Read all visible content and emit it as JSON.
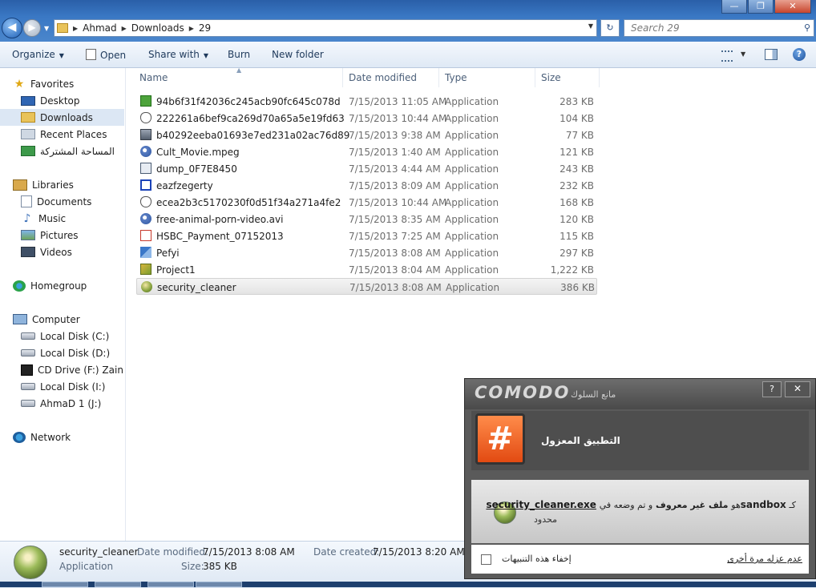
{
  "window": {
    "minimize_glyph": "—",
    "maximize_glyph": "❐",
    "close_glyph": "✕"
  },
  "address": {
    "crumbs": [
      "Ahmad",
      "Downloads",
      "29"
    ],
    "search_placeholder": "Search 29"
  },
  "toolbar": {
    "organize": "Organize",
    "open": "Open",
    "share_with": "Share with",
    "burn": "Burn",
    "new_folder": "New folder"
  },
  "nav": {
    "favorites": "Favorites",
    "desktop": "Desktop",
    "downloads": "Downloads",
    "recent_places": "Recent Places",
    "shared": "المساحة المشتركة",
    "libraries": "Libraries",
    "documents": "Documents",
    "music": "Music",
    "pictures": "Pictures",
    "videos": "Videos",
    "homegroup": "Homegroup",
    "computer": "Computer",
    "drive_c": "Local Disk (C:)",
    "drive_d": "Local Disk (D:)",
    "drive_f": "CD Drive (F:) Zain Br",
    "drive_i": "Local Disk (I:)",
    "drive_j": "AhmaD 1 (J:)",
    "network": "Network"
  },
  "columns": {
    "name": "Name",
    "date": "Date modified",
    "type": "Type",
    "size": "Size"
  },
  "files": [
    {
      "name": "94b6f31f42036c245acb90fc645c078d",
      "date": "7/15/2013 11:05 AM",
      "type": "Application",
      "size": "283 KB",
      "icon": "green-app-icon"
    },
    {
      "name": "222261a6bef9ca269d70a65a5e19fd63",
      "date": "7/15/2013 10:44 AM",
      "type": "Application",
      "size": "104 KB",
      "icon": "mouse-app-icon"
    },
    {
      "name": "b40292eeba01693e7ed231a02ac76d89",
      "date": "7/15/2013 9:38 AM",
      "type": "Application",
      "size": "77 KB",
      "icon": "photo-app-icon"
    },
    {
      "name": "Cult_Movie.mpeg",
      "date": "7/15/2013 1:40 AM",
      "type": "Application",
      "size": "121 KB",
      "icon": "media-app-icon"
    },
    {
      "name": "dump_0F7E8450",
      "date": "7/15/2013 4:44 AM",
      "type": "Application",
      "size": "243 KB",
      "icon": "window-app-icon"
    },
    {
      "name": "eazfzegerty",
      "date": "7/15/2013 8:09 AM",
      "type": "Application",
      "size": "232 KB",
      "icon": "blue-app-icon"
    },
    {
      "name": "ecea2b3c5170230f0d51f34a271a4fe2",
      "date": "7/15/2013 10:44 AM",
      "type": "Application",
      "size": "168 KB",
      "icon": "mouse-app-icon"
    },
    {
      "name": "free-animal-porn-video.avi",
      "date": "7/15/2013 8:35 AM",
      "type": "Application",
      "size": "120 KB",
      "icon": "media-app-icon"
    },
    {
      "name": "HSBC_Payment_07152013",
      "date": "7/15/2013 7:25 AM",
      "type": "Application",
      "size": "115 KB",
      "icon": "pdf-app-icon"
    },
    {
      "name": "Pefyi",
      "date": "7/15/2013 8:08 AM",
      "type": "Application",
      "size": "297 KB",
      "icon": "pefyi-app-icon"
    },
    {
      "name": "Project1",
      "date": "7/15/2013 8:04 AM",
      "type": "Application",
      "size": "1,222 KB",
      "icon": "project-app-icon"
    },
    {
      "name": "security_cleaner",
      "date": "7/15/2013 8:08 AM",
      "type": "Application",
      "size": "386 KB",
      "icon": "globe-app-icon",
      "selected": true
    }
  ],
  "details": {
    "name": "security_cleaner",
    "type": "Application",
    "date_modified_label": "Date modified:",
    "date_modified": "7/15/2013 8:08 AM",
    "date_created_label": "Date created:",
    "date_created": "7/15/2013 8:20 AM",
    "size_label": "Size:",
    "size": "385 KB"
  },
  "comodo": {
    "logo": "COMODO",
    "subtitle": "مانع السلوك",
    "help": "?",
    "close": "✕",
    "badge": "#",
    "title": "التطبيق المعزول",
    "msg_prefix": "كـ",
    "msg_sandbox": "sandbox",
    "msg_middle": "هو",
    "msg_unknown": "ملف غير معروف",
    "msg_placed": "و تم وضعه في",
    "msg_file": "security_cleaner.exe",
    "msg_limited": "محدود",
    "hide_alerts": "إخفاء هذه التنبيهات",
    "isolate_again": "عدم عزله مرة أخرى"
  }
}
